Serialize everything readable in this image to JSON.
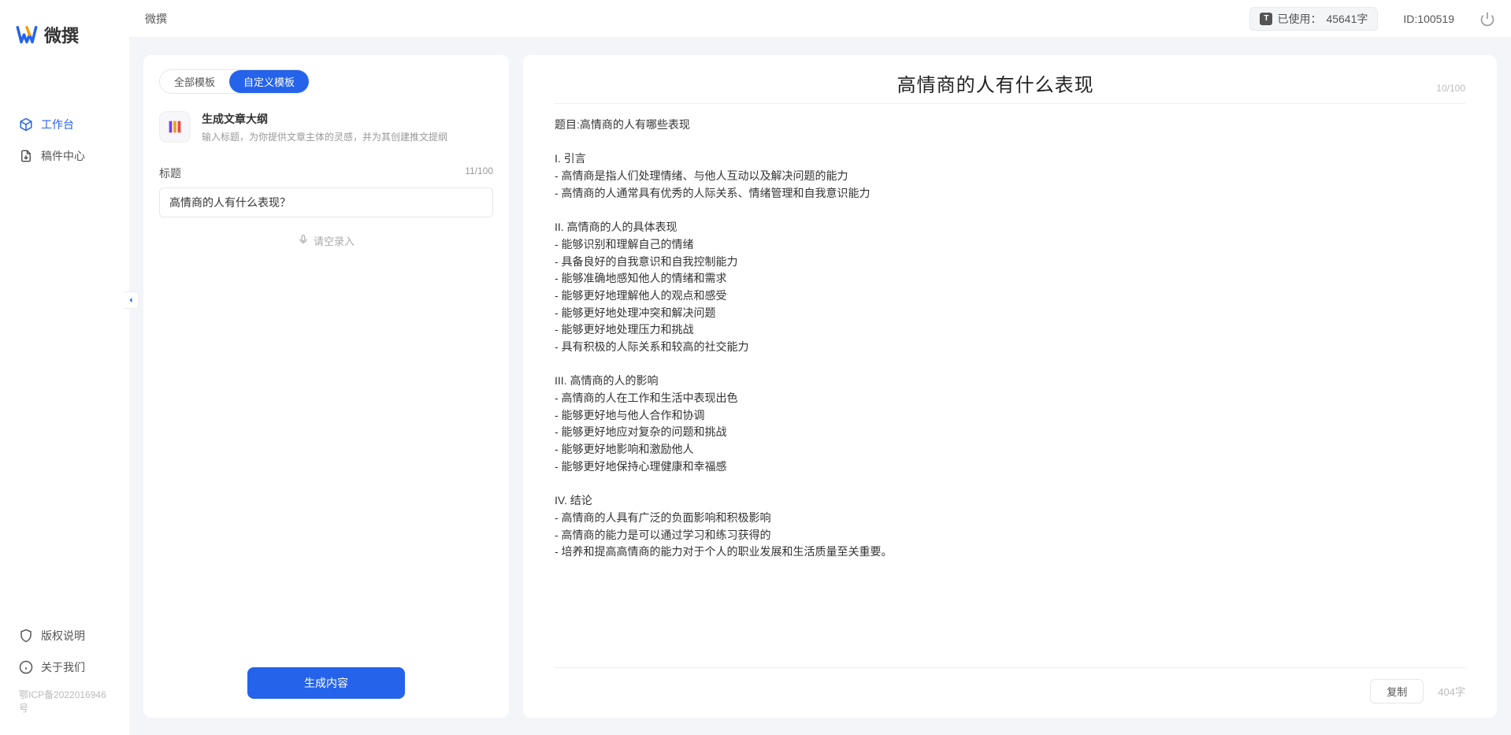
{
  "brand": {
    "name": "微撰",
    "app_name": "微撰"
  },
  "sidebar": {
    "nav": [
      {
        "label": "工作台",
        "active": true
      },
      {
        "label": "稿件中心",
        "active": false
      }
    ],
    "footer": [
      {
        "label": "版权说明"
      },
      {
        "label": "关于我们"
      }
    ],
    "license": "鄂ICP备2022016946号"
  },
  "topbar": {
    "usage_prefix": "已使用：",
    "usage_value": "45641字",
    "user_id": "ID:100519"
  },
  "leftPanel": {
    "tabs": [
      {
        "label": "全部模板",
        "active": false
      },
      {
        "label": "自定义模板",
        "active": true
      }
    ],
    "template": {
      "title": "生成文章大纲",
      "desc": "输入标题，为你提供文章主体的灵感，并为其创建推文提纲"
    },
    "field_label": "标题",
    "field_counter": "11/100",
    "title_value": "高情商的人有什么表现？",
    "voice_hint": "请空录入",
    "generate_label": "生成内容"
  },
  "rightPanel": {
    "title": "高情商的人有什么表现",
    "title_counter": "10/100",
    "content": "题目:高情商的人有哪些表现\n\nI. 引言\n- 高情商是指人们处理情绪、与他人互动以及解决问题的能力\n- 高情商的人通常具有优秀的人际关系、情绪管理和自我意识能力\n\nII. 高情商的人的具体表现\n- 能够识别和理解自己的情绪\n- 具备良好的自我意识和自我控制能力\n- 能够准确地感知他人的情绪和需求\n- 能够更好地理解他人的观点和感受\n- 能够更好地处理冲突和解决问题\n- 能够更好地处理压力和挑战\n- 具有积极的人际关系和较高的社交能力\n\nIII. 高情商的人的影响\n- 高情商的人在工作和生活中表现出色\n- 能够更好地与他人合作和协调\n- 能够更好地应对复杂的问题和挑战\n- 能够更好地影响和激励他人\n- 能够更好地保持心理健康和幸福感\n\nIV. 结论\n- 高情商的人具有广泛的负面影响和积极影响\n- 高情商的能力是可以通过学习和练习获得的\n- 培养和提高高情商的能力对于个人的职业发展和生活质量至关重要。",
    "copy_label": "复制",
    "word_count": "404字"
  }
}
